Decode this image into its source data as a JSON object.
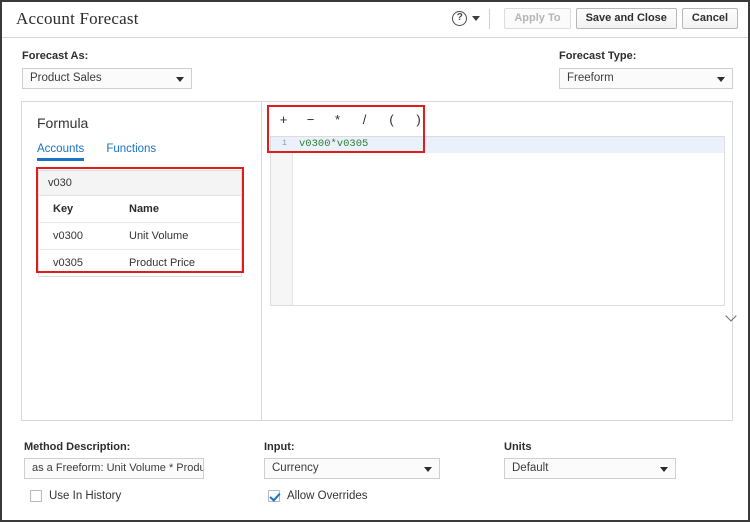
{
  "window": {
    "title": "Account Forecast"
  },
  "header": {
    "title": "Account Forecast",
    "help_icon": "help-circle-icon",
    "help_caret_icon": "caret-down-icon",
    "buttons": [
      {
        "label": "Apply To",
        "state": "disabled"
      },
      {
        "label": "Save and Close",
        "state": "enabled"
      },
      {
        "label": "Cancel",
        "state": "enabled"
      }
    ]
  },
  "top_fields": {
    "forecast_as": {
      "label": "Forecast As:",
      "value": "Product Sales",
      "arrow_icon": "caret-down-icon"
    },
    "forecast_type": {
      "label": "Forecast Type:",
      "value": "Freeform",
      "arrow_icon": "caret-down-icon"
    }
  },
  "formula_panel": {
    "title": "Formula",
    "tabs": [
      {
        "label": "Accounts",
        "active": true
      },
      {
        "label": "Functions",
        "active": false
      }
    ],
    "accounts_table": {
      "filter_value": "v030",
      "columns": [
        "Key",
        "Name"
      ],
      "rows": [
        {
          "key": "v0300",
          "name": "Unit Volume"
        },
        {
          "key": "v0305",
          "name": "Product Price"
        }
      ]
    }
  },
  "editor": {
    "operators": [
      "+",
      "−",
      "*",
      "/",
      "(",
      ")"
    ],
    "lines": [
      {
        "number": "1",
        "text": "v0300*v0305"
      }
    ],
    "collapse_icon": "chevron-down-icon"
  },
  "bottom_fields": {
    "method_description": {
      "label": "Method Description:",
      "value": "as a Freeform:  Unit Volume * Product"
    },
    "input": {
      "label": "Input:",
      "value": "Currency",
      "arrow_icon": "caret-down-icon"
    },
    "units": {
      "label": "Units",
      "value": "Default",
      "arrow_icon": "caret-down-icon"
    },
    "checkboxes": [
      {
        "label": "Use In History",
        "checked": false
      },
      {
        "label": "Allow Overrides",
        "checked": true
      }
    ]
  },
  "annotations": [
    {
      "name": "accounts-table-highlight",
      "color": "#e01b1b"
    },
    {
      "name": "operators-and-formula-highlight",
      "color": "#e01b1b"
    }
  ]
}
